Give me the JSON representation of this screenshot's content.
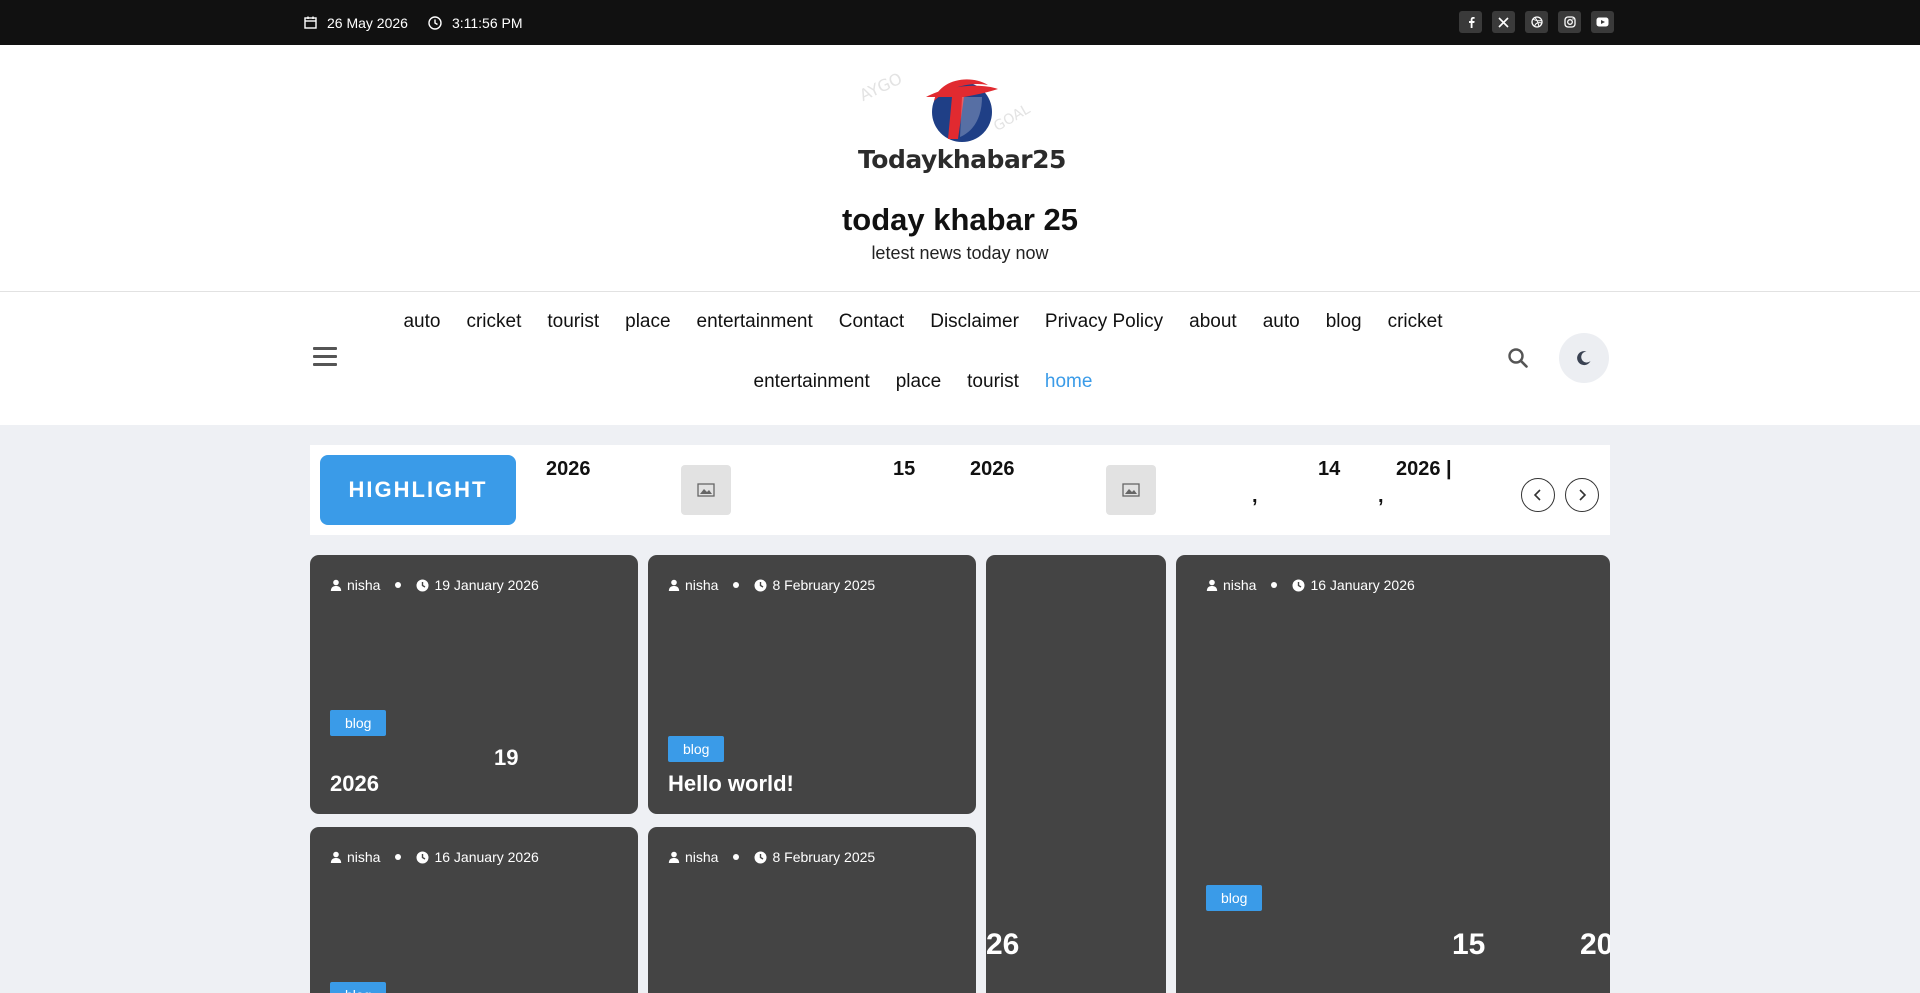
{
  "topbar": {
    "date": "26 May 2026",
    "time": "3:11:56 PM",
    "social": [
      "facebook-icon",
      "x-icon",
      "dribbble-icon",
      "instagram-icon",
      "youtube-icon"
    ]
  },
  "header": {
    "logo_text": "Todaykhabar25",
    "site_title": "today khabar 25",
    "tagline": "letest news today now"
  },
  "nav": {
    "items": [
      "auto",
      "cricket",
      "tourist",
      "place",
      "entertainment",
      "Contact",
      "Disclaimer",
      "Privacy Policy",
      "about",
      "auto",
      "blog",
      "cricket",
      "entertainment",
      "place",
      "tourist",
      "home"
    ],
    "active": "home"
  },
  "ticker": {
    "label": "HIGHLIGHT",
    "texts": [
      "2026",
      "15",
      "2026",
      "14",
      "2026 |",
      ",",
      ","
    ]
  },
  "cards": [
    {
      "author": "nisha",
      "date": "19 January 2026",
      "category": "blog",
      "title_parts": [
        "19",
        "2026"
      ]
    },
    {
      "author": "nisha",
      "date": "8 February 2025",
      "category": "blog",
      "title": "Hello world!"
    },
    {
      "title_parts": [
        "26"
      ]
    },
    {
      "author": "nisha",
      "date": "16 January 2026",
      "category": "blog",
      "title_parts": [
        "15",
        "20"
      ]
    },
    {
      "author": "nisha",
      "date": "16 January 2026",
      "category": "blog"
    },
    {
      "author": "nisha",
      "date": "8 February 2025"
    }
  ],
  "colors": {
    "accent": "#3a9be8",
    "topbar": "#111111",
    "card": "#444444",
    "page_bg": "#eef0f4"
  }
}
